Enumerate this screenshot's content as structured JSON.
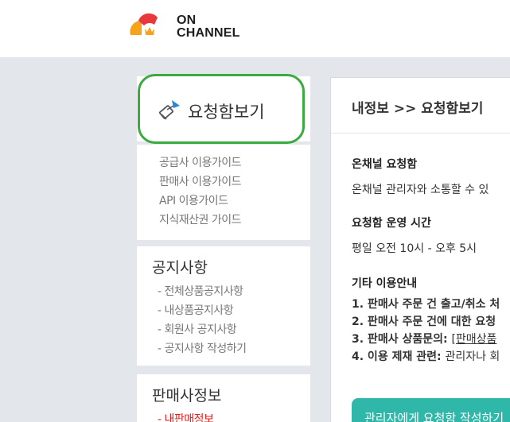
{
  "header": {
    "logo_line1": "ON",
    "logo_line2": "CHANNEL"
  },
  "sidebar": {
    "title": "요청함보기",
    "title_icon": "request-box-icon",
    "guides": [
      "공급사 이용가이드",
      "판매사 이용가이드",
      "API 이용가이드",
      "지식재산권 가이드"
    ],
    "notice": {
      "title": "공지사항",
      "items": [
        "- 전체상품공지사항",
        "- 내상품공지사항",
        "- 회원사 공지사항",
        "- 공지사항 작성하기"
      ]
    },
    "seller": {
      "title": "판매사정보",
      "items": [
        "- 내판매정보"
      ]
    }
  },
  "main": {
    "breadcrumb": "내정보 >> 요청함보기",
    "section1_title": "온채널 요청함",
    "section1_text": "온채널 관리자와 소통할 수 있",
    "section2_title": "요청함 운영 시간",
    "section2_text": "평일 오전 10시 - 오후 5시",
    "section3_title": "기타 이용안내",
    "guide_lines": [
      {
        "bold": "1. 판매사 주문 건 출고/취소 처",
        "rest": ""
      },
      {
        "bold": "2. 판매사 주문 건에 대한 요청",
        "rest": ""
      },
      {
        "bold": "3. 판매사 상품문의: ",
        "rest": "[판매상품"
      },
      {
        "bold": "4. 이용 제재 관련: ",
        "rest": "관리자나 회"
      }
    ],
    "cta_label": "관리자에게 요청함 작성하기"
  },
  "colors": {
    "highlight": "#3aab3f",
    "cta": "#2fb7a9",
    "active_link": "#e02020",
    "background": "#e3e7ec"
  }
}
